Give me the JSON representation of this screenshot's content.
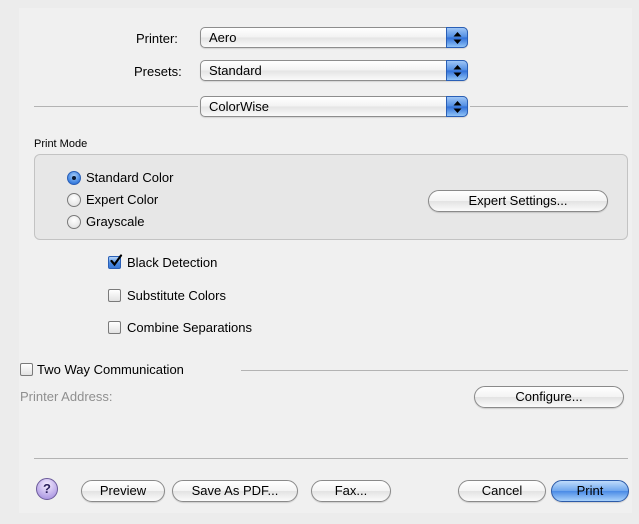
{
  "printer": {
    "label": "Printer:",
    "value": "Aero"
  },
  "presets": {
    "label": "Presets:",
    "value": "Standard"
  },
  "panel_popup": {
    "value": "ColorWise"
  },
  "print_mode": {
    "title": "Print Mode",
    "options": [
      {
        "label": "Standard Color",
        "selected": true
      },
      {
        "label": "Expert Color",
        "selected": false
      },
      {
        "label": "Grayscale",
        "selected": false
      }
    ],
    "expert_settings_label": "Expert Settings..."
  },
  "checkboxes": {
    "black_detection": {
      "label": "Black Detection",
      "checked": true
    },
    "substitute_colors": {
      "label": "Substitute Colors",
      "checked": false
    },
    "combine_separations": {
      "label": "Combine Separations",
      "checked": false
    }
  },
  "two_way": {
    "label": "Two Way Communication",
    "checked": false
  },
  "printer_address": {
    "label": "Printer Address:"
  },
  "configure_label": "Configure...",
  "footer": {
    "help_label": "?",
    "preview_label": "Preview",
    "save_pdf_label": "Save As PDF...",
    "fax_label": "Fax...",
    "cancel_label": "Cancel",
    "print_label": "Print"
  },
  "colors": {
    "accent": "#3a7fe0",
    "background": "#ececec"
  }
}
